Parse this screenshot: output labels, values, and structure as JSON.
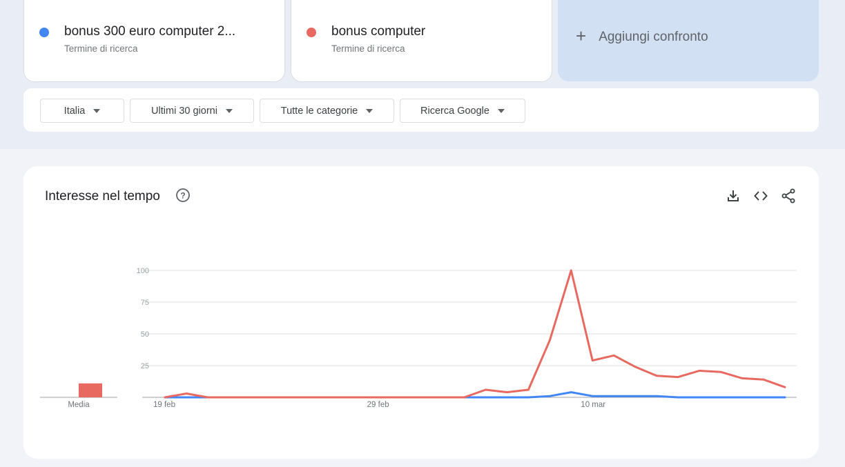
{
  "terms": [
    {
      "name": "bonus 300 euro computer 2...",
      "type": "Termine di ricerca",
      "color": "#4285f4"
    },
    {
      "name": "bonus computer",
      "type": "Termine di ricerca",
      "color": "#e8695f"
    }
  ],
  "add_compare": {
    "label": "Aggiungi confronto",
    "icon": "plus-icon"
  },
  "filters": [
    {
      "label": "Italia"
    },
    {
      "label": "Ultimi 30 giorni"
    },
    {
      "label": "Tutte le categorie"
    },
    {
      "label": "Ricerca Google"
    }
  ],
  "panel": {
    "title": "Interesse nel tempo",
    "icons": [
      "help-icon",
      "download-icon",
      "embed-code-icon",
      "share-icon"
    ]
  },
  "chart_data": {
    "type": "line",
    "title": "",
    "x": [
      "19 feb",
      "20 feb",
      "21 feb",
      "22 feb",
      "23 feb",
      "24 feb",
      "25 feb",
      "26 feb",
      "27 feb",
      "28 feb",
      "29 feb",
      "1 mar",
      "2 mar",
      "3 mar",
      "4 mar",
      "5 mar",
      "6 mar",
      "7 mar",
      "8 mar",
      "9 mar",
      "10 mar",
      "11 mar",
      "12 mar",
      "13 mar",
      "14 mar",
      "15 mar",
      "16 mar",
      "17 mar",
      "18 mar",
      "19 mar"
    ],
    "x_tick_labels": [
      "19 feb",
      "29 feb",
      "10 mar"
    ],
    "ylim": [
      0,
      100
    ],
    "y_ticks": [
      25,
      50,
      75,
      100
    ],
    "grid": true,
    "series": [
      {
        "name": "bonus 300 euro computer 2...",
        "color": "#4285f4",
        "values": [
          0,
          0,
          0,
          0,
          0,
          0,
          0,
          0,
          0,
          0,
          0,
          0,
          0,
          0,
          0,
          0,
          0,
          0,
          1,
          4,
          1,
          1,
          1,
          1,
          0,
          0,
          0,
          0,
          0,
          0
        ]
      },
      {
        "name": "bonus computer",
        "color": "#e8695f",
        "values": [
          0,
          3,
          0,
          0,
          0,
          0,
          0,
          0,
          0,
          0,
          0,
          0,
          0,
          0,
          0,
          6,
          4,
          6,
          45,
          100,
          29,
          33,
          24,
          17,
          16,
          21,
          20,
          15,
          14,
          8
        ]
      }
    ],
    "average": {
      "label": "Media",
      "values": [
        {
          "series": "bonus 300 euro computer 2...",
          "value": 0
        },
        {
          "series": "bonus computer",
          "value": 11
        }
      ]
    }
  }
}
